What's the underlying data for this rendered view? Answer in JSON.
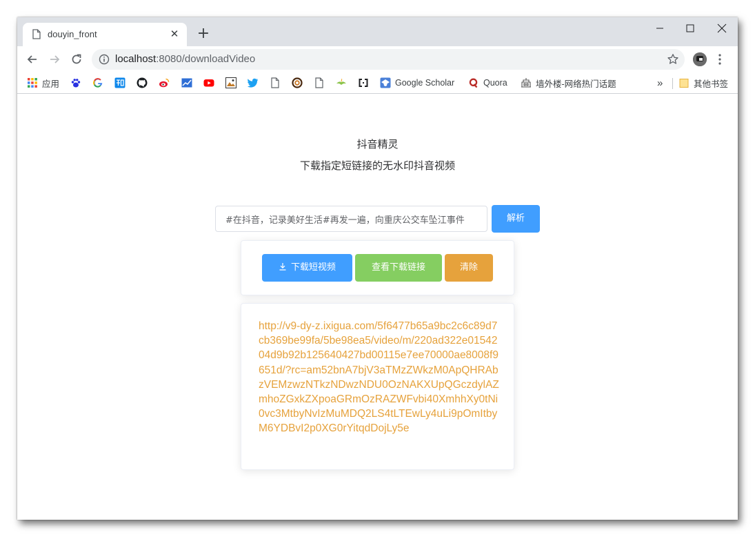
{
  "browser": {
    "tab": {
      "title": "douyin_front"
    },
    "new_tab_label": "+",
    "address": {
      "host": "localhost",
      "path": ":8080/downloadVideo"
    },
    "bookmarks": [
      {
        "label": "应用",
        "icon": "apps-grid-icon"
      },
      {
        "label": "",
        "icon": "baidu-icon"
      },
      {
        "label": "",
        "icon": "google-icon"
      },
      {
        "label": "",
        "icon": "zhihu-icon"
      },
      {
        "label": "",
        "icon": "github-icon"
      },
      {
        "label": "",
        "icon": "weibo-icon"
      },
      {
        "label": "",
        "icon": "chart-icon"
      },
      {
        "label": "",
        "icon": "youtube-icon"
      },
      {
        "label": "",
        "icon": "image-icon"
      },
      {
        "label": "",
        "icon": "twitter-icon"
      },
      {
        "label": "",
        "icon": "page-icon"
      },
      {
        "label": "",
        "icon": "ring-icon"
      },
      {
        "label": "",
        "icon": "page-icon"
      },
      {
        "label": "",
        "icon": "leaf-icon"
      },
      {
        "label": "",
        "icon": "brackets-icon"
      },
      {
        "label": "Google Scholar",
        "icon": "scholar-icon"
      },
      {
        "label": "Quora",
        "icon": "quora-icon"
      },
      {
        "label": "墙外楼-网络热门话题",
        "icon": "building-icon"
      }
    ],
    "overflow_label": "»",
    "other_bookmarks": "其他书签",
    "colors": {
      "tabstrip": "#dee1e6",
      "omnibox": "#f1f3f4"
    }
  },
  "app": {
    "title": "抖音精灵",
    "subtitle": "下载指定短链接的无水印抖音视频",
    "input": {
      "value": "#在抖音，记录美好生活#再发一遍，向重庆公交车坠江事件"
    },
    "parse_button": "解析",
    "download_button": "下载短视频",
    "view_link_button": "查看下载链接",
    "clear_button": "清除",
    "result_url": "http://v9-dy-z.ixigua.com/5f6477b65a9bc2c6c89d7cb369be99fa/5be98ea5/video/m/220ad322e0154204d9b92b125640427bd00115e7ee70000ae8008f9651d/?rc=am52bnA7bjV3aTMzZWkzM0ApQHRAbzVEMzwzNTkzNDwzNDU0OzNAKXUpQGczdylAZmhoZGxkZXpoaGRmOzRAZWFvbi40XmhhXy0tNi0vc3MtbyNvIzMuMDQ2LS4tLTEwLy4uLi9pOmItbyM6YDBvI2p0XG0rYitqdDojLy5e",
    "colors": {
      "primary": "#409eff",
      "success": "#85ce61",
      "warning": "#e6a23c"
    }
  }
}
